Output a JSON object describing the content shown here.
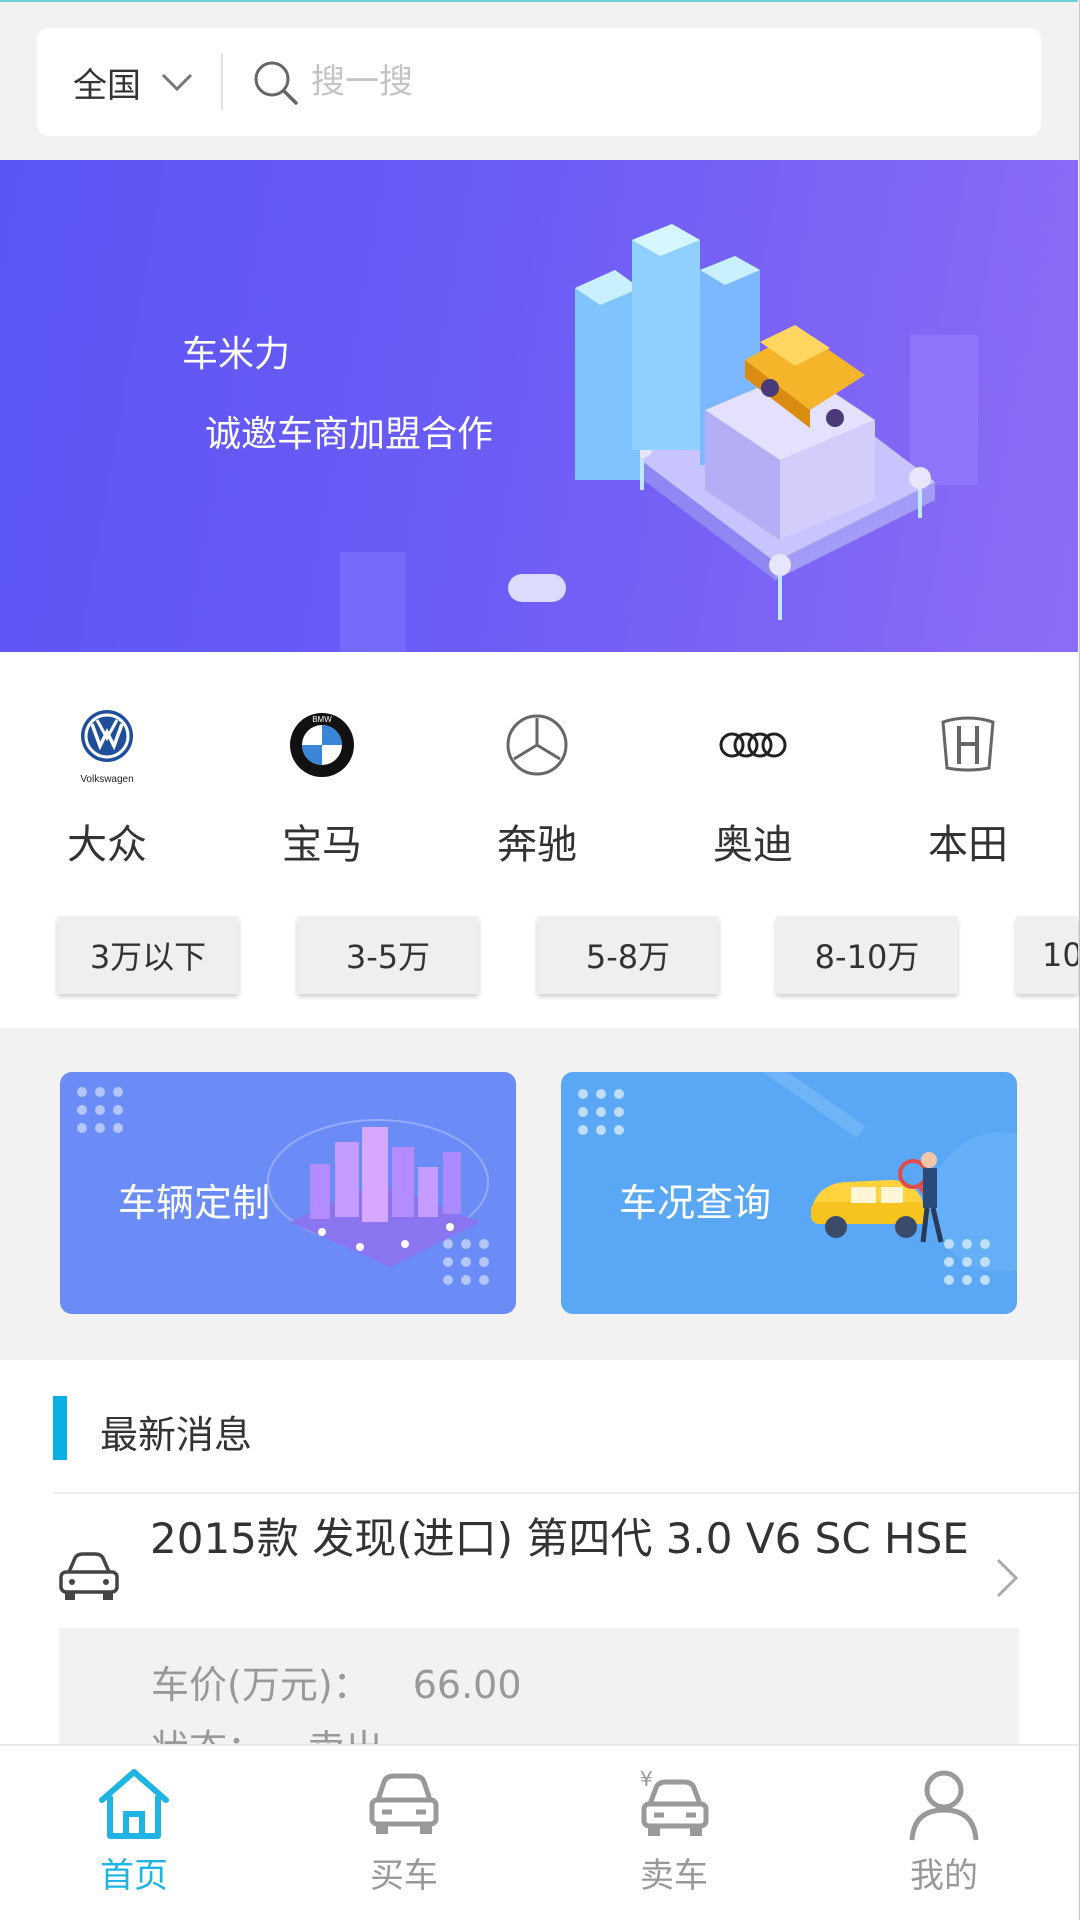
{
  "search": {
    "region": "全国",
    "placeholder": "搜一搜"
  },
  "banner": {
    "title": "车米力",
    "subtitle": "诚邀车商加盟合作"
  },
  "brands": [
    {
      "label": "大众",
      "logo_text": "Volkswagen"
    },
    {
      "label": "宝马",
      "logo_text": "BMW"
    },
    {
      "label": "奔驰"
    },
    {
      "label": "奥迪"
    },
    {
      "label": "本田"
    }
  ],
  "price_ranges": [
    "3万以下",
    "3-5万",
    "5-8万",
    "8-10万",
    "10"
  ],
  "features": [
    {
      "label": "车辆定制",
      "color": "#6b8cf7"
    },
    {
      "label": "车况查询",
      "color": "#5aa8f5"
    }
  ],
  "news": {
    "section_title": "最新消息",
    "items": [
      {
        "title": "2015款 发现(进口) 第四代 3.0 V6 SC HSE",
        "price_label": "车价(万元)：",
        "price_value": "66.00",
        "status_label": "状态：",
        "status_value": "卖出"
      }
    ]
  },
  "tabbar": {
    "active_color": "#1eb4e3",
    "items": [
      {
        "label": "首页",
        "icon": "home-icon",
        "active": true
      },
      {
        "label": "买车",
        "icon": "car-icon",
        "active": false
      },
      {
        "label": "卖车",
        "icon": "sell-car-icon",
        "active": false
      },
      {
        "label": "我的",
        "icon": "user-icon",
        "active": false
      }
    ]
  }
}
